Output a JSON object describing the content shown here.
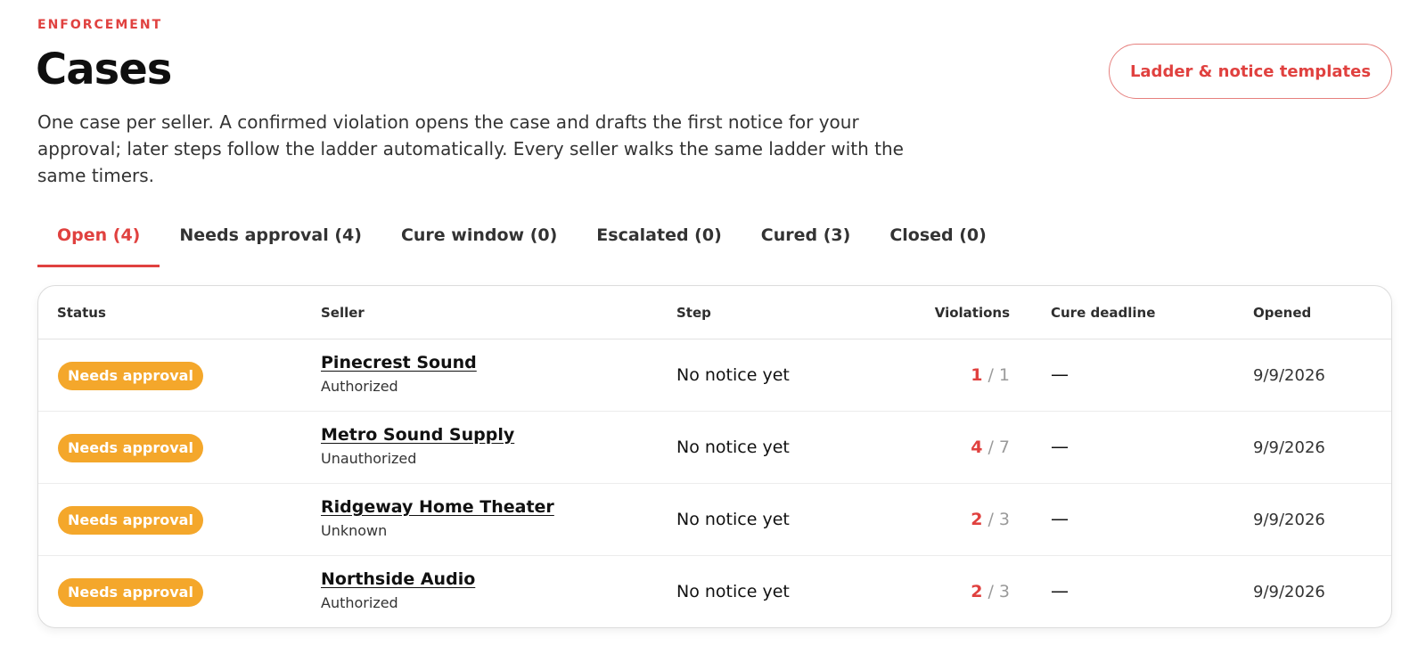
{
  "header": {
    "eyebrow": "ENFORCEMENT",
    "title": "Cases",
    "description": "One case per seller. A confirmed violation opens the case and drafts the first notice for your approval; later steps follow the ladder automatically. Every seller walks the same ladder with the same timers.",
    "templates_button": "Ladder & notice templates"
  },
  "tabs": [
    {
      "label": "Open (4)",
      "active": true
    },
    {
      "label": "Needs approval (4)",
      "active": false
    },
    {
      "label": "Cure window (0)",
      "active": false
    },
    {
      "label": "Escalated (0)",
      "active": false
    },
    {
      "label": "Cured (3)",
      "active": false
    },
    {
      "label": "Closed (0)",
      "active": false
    }
  ],
  "table": {
    "columns": {
      "status": "Status",
      "seller": "Seller",
      "step": "Step",
      "violations": "Violations",
      "cure_deadline": "Cure deadline",
      "opened": "Opened"
    },
    "rows": [
      {
        "status": "Needs approval",
        "seller": "Pinecrest Sound",
        "auth": "Authorized",
        "step": "No notice yet",
        "violations": "1",
        "violations_total": "/ 1",
        "cure_deadline": "—",
        "opened": "9/9/2026"
      },
      {
        "status": "Needs approval",
        "seller": "Metro Sound Supply",
        "auth": "Unauthorized",
        "step": "No notice yet",
        "violations": "4",
        "violations_total": "/ 7",
        "cure_deadline": "—",
        "opened": "9/9/2026"
      },
      {
        "status": "Needs approval",
        "seller": "Ridgeway Home Theater",
        "auth": "Unknown",
        "step": "No notice yet",
        "violations": "2",
        "violations_total": "/ 3",
        "cure_deadline": "—",
        "opened": "9/9/2026"
      },
      {
        "status": "Needs approval",
        "seller": "Northside Audio",
        "auth": "Authorized",
        "step": "No notice yet",
        "violations": "2",
        "violations_total": "/ 3",
        "cure_deadline": "—",
        "opened": "9/9/2026"
      }
    ]
  },
  "colors": {
    "accent": "#e0413f",
    "badge": "#f4a72b",
    "muted": "#9a9a9a"
  }
}
